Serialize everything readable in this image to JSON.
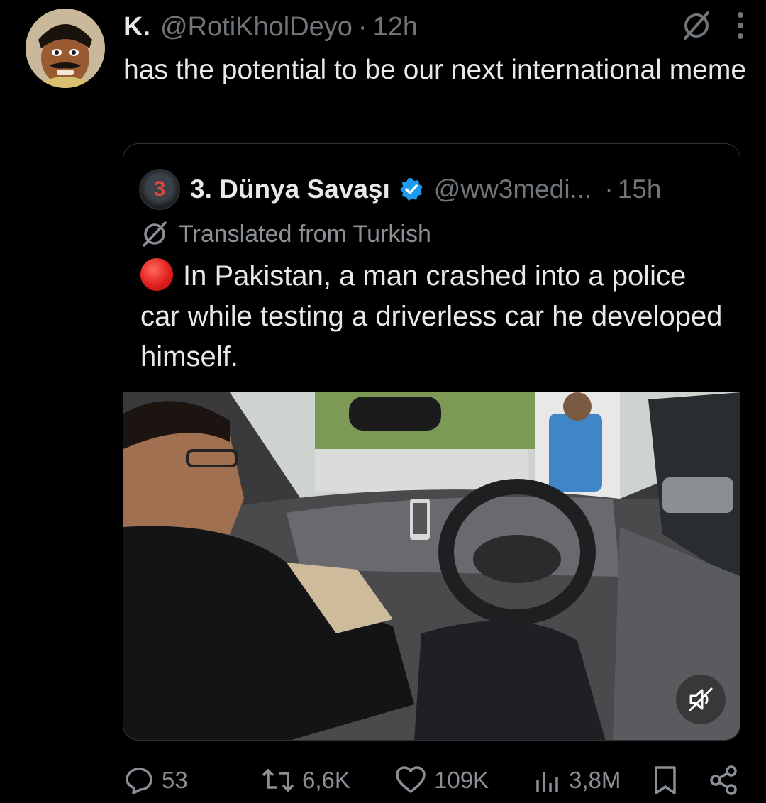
{
  "tweet": {
    "display_name": "K.",
    "handle": "@RotiKholDeyo",
    "separator": "·",
    "time": "12h",
    "text": "has the potential to be our next international meme",
    "avatar_icon": "profile-avatar"
  },
  "quoted": {
    "avatar_label": "3",
    "display_name": "3. Dünya Savaşı",
    "verified_icon": "verified-badge-icon",
    "handle": "@ww3medi...",
    "separator": "·",
    "time": "15h",
    "translated_label": "Translated from Turkish",
    "text": "In Pakistan, a man crashed into a police car while testing a driverless car he developed himself.",
    "media_type": "video",
    "mute_icon": "muted-speaker-icon"
  },
  "actions": {
    "replies": "53",
    "reposts": "6,6K",
    "likes": "109K",
    "views": "3,8M"
  },
  "colors": {
    "background": "#000000",
    "text": "#e7e9ea",
    "muted": "#71767b",
    "verified": "#1d9bf0",
    "border": "#2f3336"
  }
}
